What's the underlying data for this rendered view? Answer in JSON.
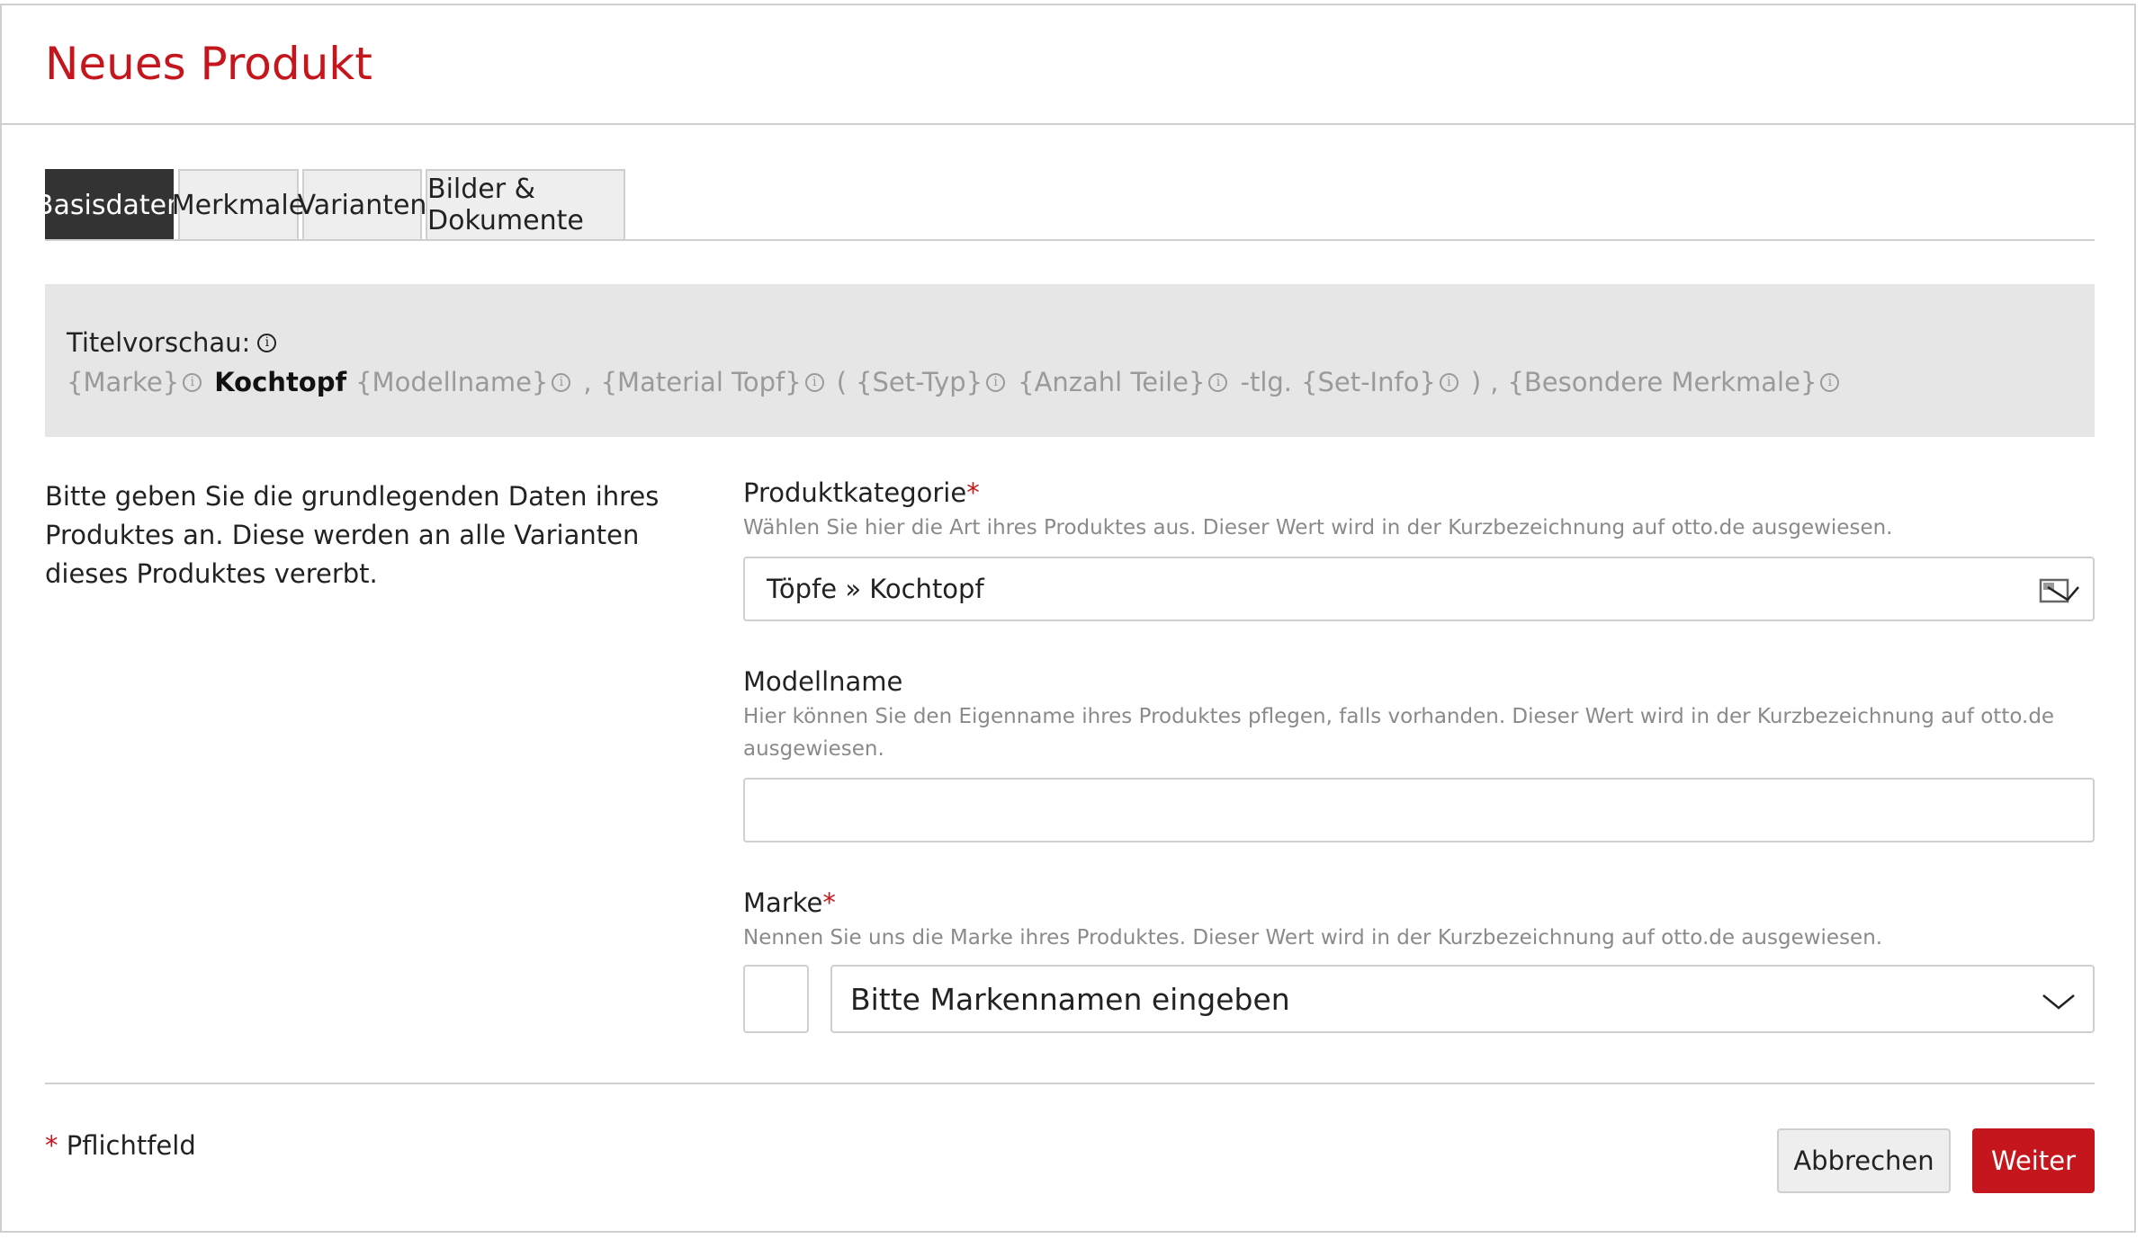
{
  "dialog": {
    "title": "Neues Produkt"
  },
  "tabs": [
    {
      "label": "Basisdaten",
      "active": true
    },
    {
      "label": "Merkmale",
      "active": false
    },
    {
      "label": "Varianten",
      "active": false
    },
    {
      "label": "Bilder & Dokumente",
      "active": false
    }
  ],
  "preview": {
    "label": "Titelvorschau:",
    "parts": {
      "marke": "{Marke}",
      "kochtopf": "Kochtopf",
      "modellname": "{Modellname}",
      "comma1": ",",
      "material": "{Material Topf}",
      "paren_open": "(",
      "settyp": "{Set-Typ}",
      "anzahl": "{Anzahl Teile}",
      "tlg": "-tlg.",
      "setinfo": "{Set-Info}",
      "paren_close": ")",
      "comma2": ",",
      "besondere": "{Besondere Merkmale}"
    }
  },
  "intro": "Bitte geben Sie die grundlegenden Daten ihres Produktes an. Diese werden an alle Varianten dieses Produktes vererbt.",
  "fields": {
    "kategorie": {
      "label": "Produktkategorie",
      "required_mark": "*",
      "help": "Wählen Sie hier die Art ihres Produktes aus. Dieser Wert wird in der Kurzbezeichnung auf otto.de ausgewiesen.",
      "value": "Töpfe » Kochtopf"
    },
    "modellname": {
      "label": "Modellname",
      "help": "Hier können Sie den Eigenname ihres Produktes pflegen, falls vorhanden. Dieser Wert wird in der Kurzbezeichnung auf otto.de ausgewiesen.",
      "value": ""
    },
    "marke": {
      "label": "Marke",
      "required_mark": "*",
      "help": "Nennen Sie uns die Marke ihres Produktes. Dieser Wert wird in der Kurzbezeichnung auf otto.de ausgewiesen.",
      "placeholder": "Bitte Markennamen eingeben"
    }
  },
  "footer": {
    "required_mark": "*",
    "required_note": "Pflichtfeld",
    "cancel_label": "Abbrechen",
    "next_label": "Weiter"
  },
  "colors": {
    "accent": "#c4161c",
    "active_tab": "#333333",
    "preview_bg": "#e6e6e6"
  },
  "icons": [
    "info-icon",
    "select-icon",
    "chevron-down-icon"
  ]
}
